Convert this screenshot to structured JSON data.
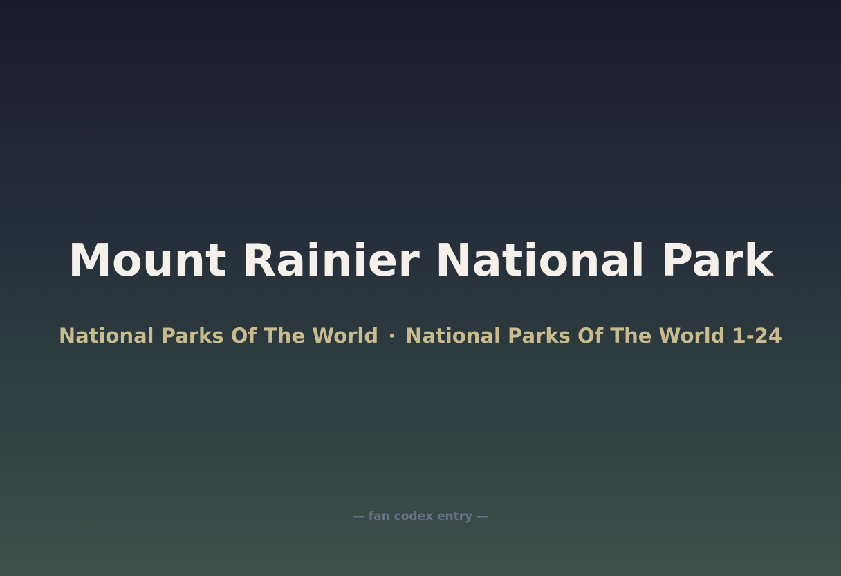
{
  "title": "Mount Rainier National Park",
  "subtitle": {
    "collection": "National Parks Of The World",
    "separator": "·",
    "set": "National Parks Of The World 1-24"
  },
  "footer": "— fan codex entry —",
  "colors": {
    "title": "#f5f0ea",
    "subtitle": "#c9bb8f",
    "footer": "#6b6f8a",
    "background_top": "#1c1a2e",
    "background_bottom": "#3d5049"
  }
}
